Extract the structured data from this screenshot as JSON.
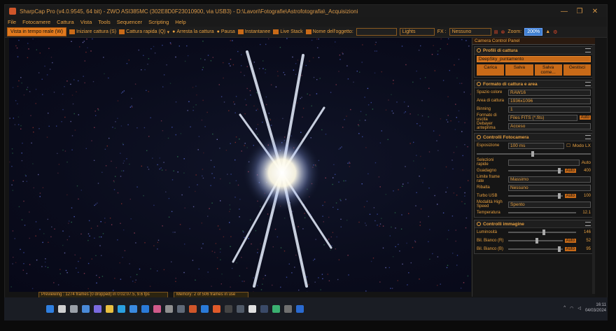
{
  "window": {
    "title": "SharpCap Pro (v4.0.9545, 64 bit) - ZWO ASI385MC (302E8D0F23010900, via USB3) - D:\\Lavori\\Fotografie\\Astrofotografia\\_Acquisizioni",
    "minimize": "—",
    "maximize": "❐",
    "close": "✕"
  },
  "menu": [
    "File",
    "Fotocamere",
    "Cattura",
    "Vista",
    "Tools",
    "Sequencer",
    "Scripting",
    "Help"
  ],
  "toolbar": {
    "live_view": "Vista in tempo reale (W)",
    "start_capture": "Iniziare cattura (S)",
    "quick_capture": "Cattura rapida (Q)",
    "stop_capture": "Arresta la cattura",
    "pause": "Pausa",
    "snapshot": "Instantanee",
    "live_stack": "Live Stack",
    "object_name_label": "Nome dell'oggetto:",
    "object_name_value": "",
    "frame_type": "Lights",
    "fx_label": "FX :",
    "fx_value": "Nessuno",
    "zoom_label": "Zoom:",
    "zoom_value": "200%"
  },
  "status": {
    "preview": "Previewing : 1274 frames (0 dropped) in 0:02:07.5, 9.6 fps",
    "memory": "Memory: 2 of 506 frames in use"
  },
  "panel": {
    "title": "Camera Control Panel",
    "profiles": {
      "header": "Profili di cattura",
      "selected": "DeepSky_puntamento",
      "buttons": [
        "Carica",
        "Salva",
        "Salva come...",
        "Gestisci"
      ]
    },
    "format": {
      "header": "Formato di cattura e area",
      "rows": [
        {
          "label": "Spazio colore",
          "value": "RAW16"
        },
        {
          "label": "Area di cattura",
          "value": "1936x1096"
        },
        {
          "label": "Binning",
          "value": "1"
        },
        {
          "label": "Formato di uscita",
          "value": "Files FITS (*.fits)",
          "auto": "Auto"
        },
        {
          "label": "Debayer anteprima",
          "value": "Acceso"
        }
      ]
    },
    "camera": {
      "header": "Controlli Fotocamera",
      "exposure_label": "Esposizione",
      "exposure_value": "100 ms",
      "lx_mode": "Modo LX",
      "quick_select_label": "Selezioni rapide",
      "quick_select_auto": "Auto",
      "gain_label": "Guadagno",
      "gain_auto": "Auto",
      "gain_value": "400",
      "frame_limit_label": "Limite frame rate",
      "frame_limit_value": "Massimo",
      "flip_label": "Ribalta",
      "flip_value": "Nessuno",
      "turbo_label": "Turbo USB",
      "turbo_auto": "Auto",
      "turbo_value": "100",
      "high_speed_label": "Modalità High Speed",
      "high_speed_value": "Spento",
      "temperature_label": "Temperatura",
      "temperature_value": "12.1"
    },
    "image": {
      "header": "Controlli immagine",
      "brightness_label": "Luminosità",
      "brightness_value": "146",
      "wb_red_label": "Bil. Bianco (R)",
      "wb_red_auto": "Auto",
      "wb_red_value": "52",
      "wb_blue_label": "Bil. Bianco (B)",
      "wb_blue_auto": "Auto",
      "wb_blue_value": "95"
    }
  },
  "taskbar": {
    "icons": [
      "windows-start",
      "search",
      "task-view",
      "widgets",
      "chat",
      "file-explorer",
      "edge",
      "store",
      "mail",
      "photos",
      "settings",
      "camera",
      "sharpcap",
      "vscode",
      "office",
      "terminal",
      "calculator",
      "zwo",
      "steam",
      "maps",
      "printer",
      "hp"
    ],
    "time": "16:11",
    "date": "04/03/2024"
  },
  "colors": {
    "accent": "#e8a040",
    "button": "#c86a18",
    "background": "#141414"
  }
}
